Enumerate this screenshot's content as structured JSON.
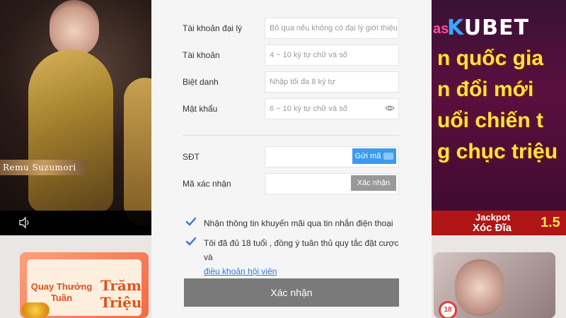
{
  "background": {
    "left_banner": {
      "model_name": "Remu Suzumori"
    },
    "right_banner": {
      "logo_prefix": "as",
      "logo_k": "K",
      "logo_rest": "UBET",
      "promo_lines": [
        "n quốc gia",
        "n đổi mới",
        "uổi chiến t",
        "g chục triệu"
      ],
      "jackpot_label": "Jackpot",
      "jackpot_game": "Xóc Đĩa",
      "jackpot_amount": "1.5"
    },
    "promo_card": {
      "title_line1": "Quay Thưởng",
      "title_line2": "Tuần",
      "prize_line1": "Trăm",
      "prize_line2": "Triệu"
    },
    "age_badge": "18"
  },
  "form": {
    "agent_account": {
      "label": "Tài khoản đại lý",
      "placeholder": "Bỏ qua nếu không có đại lý giới thiệu"
    },
    "account": {
      "label": "Tài khoản",
      "placeholder": "4 ~ 10 ký tự chữ và số"
    },
    "nickname": {
      "label": "Biệt danh",
      "placeholder": "Nhập tối đa 8 ký tự"
    },
    "password": {
      "label": "Mật khẩu",
      "placeholder": "6 ~ 10 ký tự chữ và số"
    },
    "phone": {
      "label": "SĐT",
      "value": "",
      "send_button": "Gửi mã"
    },
    "verify_code": {
      "label": "Mã xác nhận",
      "value": "",
      "verify_button": "Xác nhận"
    },
    "checkboxes": [
      {
        "text": "Nhận thông tin khuyến mãi qua tin nhắn điện thoại",
        "checked": true
      },
      {
        "text": "Tôi đã đủ 18 tuổi , đồng ý tuân thủ quy tắc đặt cược và",
        "link_text": "điều khoản hội viên",
        "checked": true
      }
    ],
    "submit_label": "Xác nhận"
  },
  "colors": {
    "accent_blue": "#3a9bf0",
    "check_blue": "#2f7bd6",
    "submit_gray": "#7a7a7a",
    "promo_yellow": "#ffe24a"
  }
}
